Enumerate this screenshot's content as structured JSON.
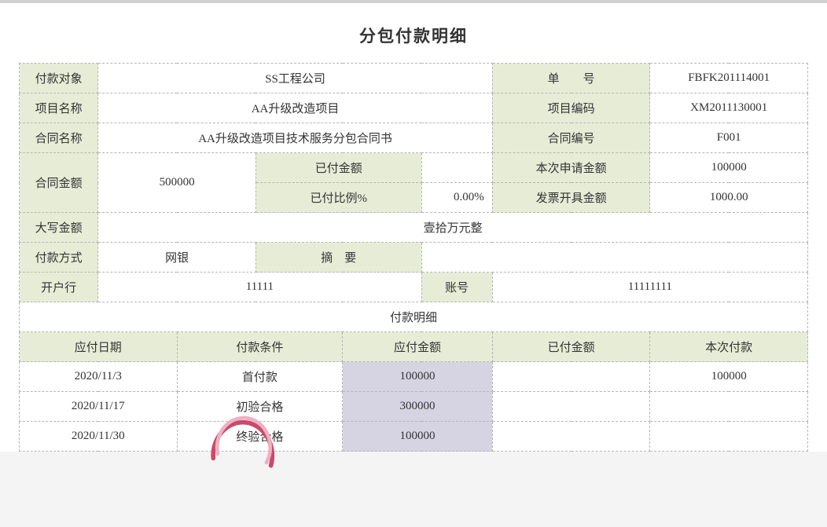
{
  "title": "分包付款明细",
  "form": {
    "payee_label": "付款对象",
    "payee": "SS工程公司",
    "bill_no_label": "单　　号",
    "bill_no": "FBFK201114001",
    "project_name_label": "项目名称",
    "project_name": "AA升级改造项目",
    "project_code_label": "项目编码",
    "project_code": "XM2011130001",
    "contract_name_label": "合同名称",
    "contract_name": "AA升级改造项目技术服务分包合同书",
    "contract_no_label": "合同编号",
    "contract_no": "F001",
    "contract_amount_label": "合同金额",
    "contract_amount": "500000",
    "paid_amount_label": "已付金额",
    "paid_amount": "",
    "this_apply_amount_label": "本次申请金额",
    "this_apply_amount": "100000",
    "paid_ratio_label": "已付比例%",
    "paid_ratio": "0.00%",
    "invoice_amount_label": "发票开具金额",
    "invoice_amount": "1000.00",
    "capital_amount_label": "大写金额",
    "capital_amount": "壹拾万元整",
    "pay_method_label": "付款方式",
    "pay_method": "网银",
    "summary_label": "摘　要",
    "summary": "",
    "bank_label": "开户行",
    "bank": "11111",
    "account_label": "账号",
    "account": "11111111"
  },
  "detail": {
    "section_title": "付款明细",
    "headers": {
      "due_date": "应付日期",
      "condition": "付款条件",
      "due_amount": "应付金额",
      "paid_amount": "已付金额",
      "this_pay": "本次付款"
    },
    "rows": [
      {
        "due_date": "2020/11/3",
        "condition": "首付款",
        "due_amount": "100000",
        "paid_amount": "",
        "this_pay": "100000"
      },
      {
        "due_date": "2020/11/17",
        "condition": "初验合格",
        "due_amount": "300000",
        "paid_amount": "",
        "this_pay": ""
      },
      {
        "due_date": "2020/11/30",
        "condition": "终验合格",
        "due_amount": "100000",
        "paid_amount": "",
        "this_pay": ""
      }
    ]
  }
}
